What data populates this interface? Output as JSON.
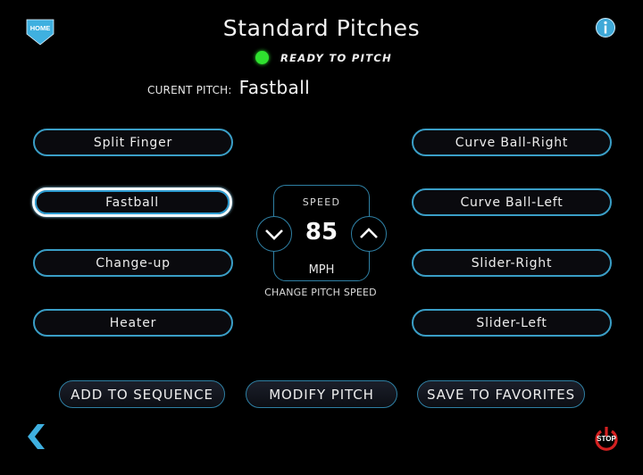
{
  "header": {
    "home_label": "HOME",
    "title": "Standard Pitches",
    "status_text": "READY TO PITCH",
    "status_color": "#2fe02f",
    "info_icon": "info-icon"
  },
  "current_pitch": {
    "label": "CURENT PITCH:",
    "value": "Fastball"
  },
  "pitches_left": [
    {
      "label": "Split Finger",
      "selected": false
    },
    {
      "label": "Fastball",
      "selected": true
    },
    {
      "label": "Change-up",
      "selected": false
    },
    {
      "label": "Heater",
      "selected": false
    }
  ],
  "pitches_right": [
    {
      "label": "Curve Ball-Right",
      "selected": false
    },
    {
      "label": "Curve Ball-Left",
      "selected": false
    },
    {
      "label": "Slider-Right",
      "selected": false
    },
    {
      "label": "Slider-Left",
      "selected": false
    }
  ],
  "speed": {
    "label": "SPEED",
    "value": "85",
    "unit": "MPH",
    "hint": "CHANGE PITCH SPEED",
    "decrease_icon": "chevron-down-icon",
    "increase_icon": "chevron-up-icon"
  },
  "actions": {
    "add_to_sequence": "ADD TO SEQUENCE",
    "modify_pitch": "MODIFY PITCH",
    "save_to_favorites": "SAVE TO FAVORITES"
  },
  "footer": {
    "back_icon": "chevron-left-icon",
    "stop_label": "STOP"
  },
  "colors": {
    "accent": "#3a9ec6",
    "home": "#3fb0e0",
    "stop": "#d42020"
  }
}
